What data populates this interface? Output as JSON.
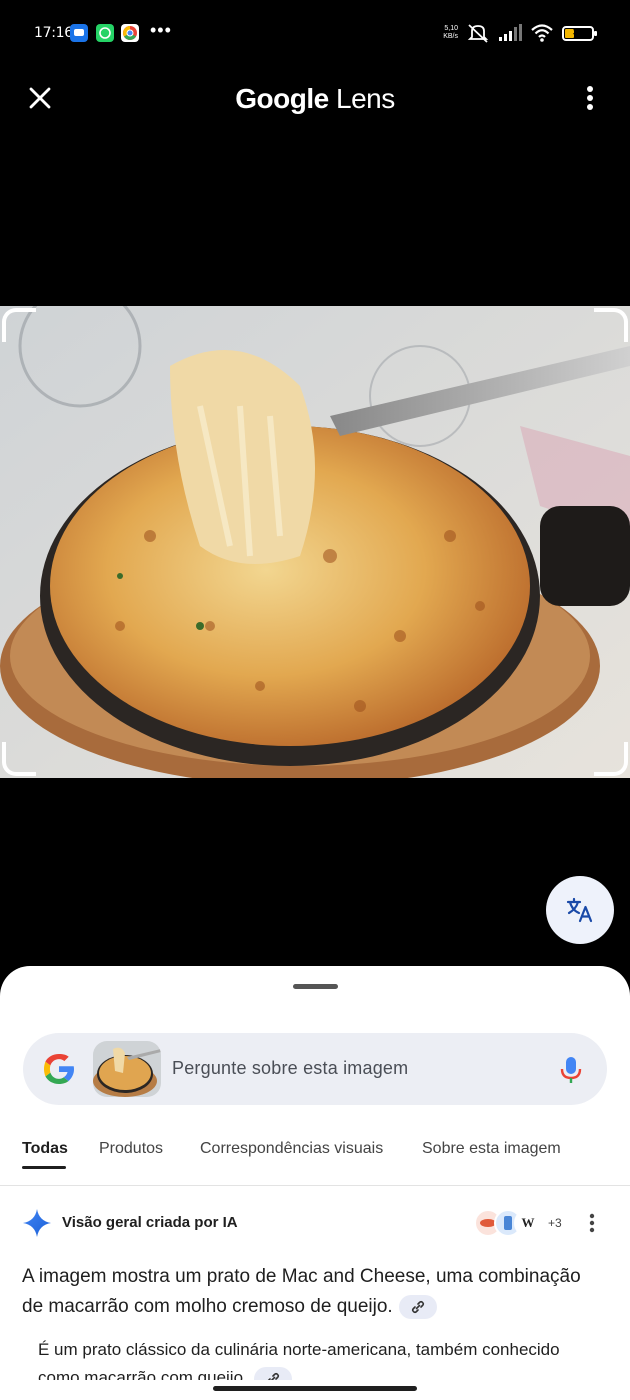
{
  "status_bar": {
    "time": "17:16",
    "more": "•••",
    "net_speed_top": "5,10",
    "net_speed_bottom": "KB/s",
    "battery_label": "35",
    "battery_level": 0.35
  },
  "header": {
    "title_brand": "Google",
    "title_product": "Lens"
  },
  "search": {
    "placeholder": "Pergunte sobre esta imagem"
  },
  "tabs": [
    {
      "label": "Todas",
      "active": true
    },
    {
      "label": "Produtos",
      "active": false
    },
    {
      "label": "Correspondências visuais",
      "active": false
    },
    {
      "label": "Sobre esta imagem",
      "active": false
    }
  ],
  "ai_overview": {
    "title": "Visão geral criada por IA",
    "sources_more": "+3",
    "paragraph": "A imagem mostra um prato de Mac and Cheese, uma combinação de macarrão com molho cremoso de queijo.",
    "bullet": "É um prato clássico da culinária norte-americana, também conhecido como macarrão com queijo."
  },
  "colors": {
    "accent_blue": "#4285f4",
    "google_red": "#ea4335",
    "google_yellow": "#fbbc05",
    "google_green": "#34a853",
    "sheet_bg": "#ffffff",
    "search_bg": "#eceef4"
  },
  "icons": {
    "close": "close-icon",
    "more": "more-vert-icon",
    "translate": "translate-icon",
    "mic": "mic-icon",
    "spark": "gemini-spark-icon",
    "link": "link-icon"
  }
}
